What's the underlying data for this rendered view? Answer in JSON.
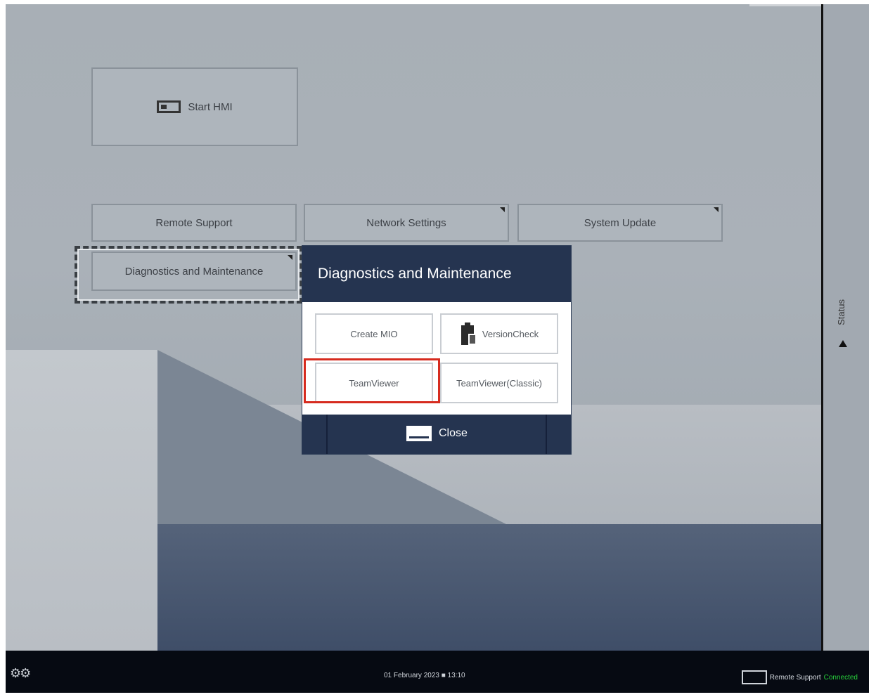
{
  "launcher": {
    "start_hmi_label": "Start HMI",
    "remote_support_label": "Remote Support",
    "network_settings_label": "Network Settings",
    "system_update_label": "System Update",
    "diagnostics_label": "Diagnostics and Maintenance"
  },
  "dialog": {
    "title": "Diagnostics and Maintenance",
    "buttons": [
      "Create MIO",
      "VersionCheck",
      "TeamViewer",
      "TeamViewer(Classic)"
    ],
    "close_label": "Close"
  },
  "status_panel": {
    "label": "Status"
  },
  "taskbar": {
    "logo": "⚙⚙",
    "datetime": "01 February 2023 ■ 13:10",
    "remote_label": "Remote Support",
    "remote_status": "Connected"
  },
  "colors": {
    "dialog_header": "#253450",
    "highlight": "#d62b1f",
    "connected": "#28d23c"
  },
  "icons": [
    "hmi-screen-icon",
    "clipboard-icon",
    "close-keyboard-icon",
    "status-up-arrow-icon",
    "monitor-icon",
    "machine-logo-icon"
  ]
}
